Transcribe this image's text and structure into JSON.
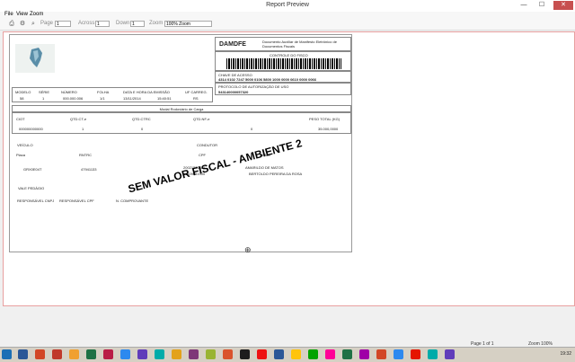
{
  "window": {
    "title": "Report Preview",
    "minimize": "—",
    "maximize": "☐",
    "close": "✕"
  },
  "menu": [
    "File",
    "View",
    "Zoom"
  ],
  "toolbar": {
    "page_label": "Page",
    "page_value": "1",
    "across_label": "Across",
    "across_value": "1",
    "down_label": "Down",
    "down_value": "1",
    "zoom_label": "Zoom",
    "zoom_value": "100% Zoom"
  },
  "report": {
    "damdfe": "DAMDFE",
    "damdfe_desc": "Documento Auxiliar de Manifesto Eletrônico de Documentos Fiscais",
    "controle_label": "CONTROLE DO FISCO",
    "chave_label": "CHAVE DE ACESSO",
    "chave_value": "4314 0102 7247 5000 0106 5800 1000 0000 0610 0000 0066",
    "protocolo_label": "PROTOCOLO DE AUTORIZAÇÃO DE USO",
    "protocolo_value": "543140000057320",
    "ident_headers": [
      "MODELO",
      "SÉRIE",
      "NÚMERO",
      "FOLHA",
      "DATA E HORA DA EMISSÃO",
      "UF CARREG."
    ],
    "ident_values": [
      "58",
      "1",
      "000.000.006",
      "1/1",
      "13/11/2014",
      "15:40:51",
      "RS"
    ],
    "modal_title": "Modal Rodoviário de Carga",
    "ciot_headers": [
      "CIOT",
      "QTD.CT-e",
      "QTD.CTRC",
      "QTD.NF-e",
      "PESO TOTAL (KG)"
    ],
    "ciot_values": [
      "000000000000",
      "1",
      "0",
      "0",
      "35.000,0000"
    ],
    "veiculo_label": "VEÍCULO",
    "condutor_label": "CONDUTOR",
    "placa_label": "Placa",
    "rntrc_label": "RNTRC",
    "cpf_label": "CPF",
    "nome_label": "NOME",
    "placa_value": "GRX0E04T",
    "rntrc_value": "47941133",
    "cpf_values": [
      "20021530887",
      "41109651900"
    ],
    "nome_values": [
      "AMARILDO DE MATOS",
      "BERTOLDO PEREIRA DA ROSA"
    ],
    "vale_pedagio": "VALE PEDÁGIO",
    "resp_headers": [
      "RESPONSÁVEL CNPJ",
      "RESPONSÁVEL CPF",
      "N. COMPROVANTE"
    ],
    "watermark": "SEM VALOR FISCAL - AMBIENTE 2"
  },
  "status": {
    "page": "Page 1 of 1",
    "zoom": "Zoom 100%"
  },
  "taskbar": {
    "clock": "19:32",
    "icon_colors": [
      "#2b5797",
      "#d24726",
      "#c0392b",
      "#f0a030",
      "#1e7145",
      "#b91d47",
      "#2d89ef",
      "#603cba",
      "#00aba9",
      "#e3a21a",
      "#7e3878",
      "#99b433",
      "#da532c",
      "#1d1d1d",
      "#ee1111",
      "#2b5797",
      "#ffc40d",
      "#00a300",
      "#ff0097",
      "#1e7145",
      "#9f00a7",
      "#d24726",
      "#2d89ef",
      "#e51400",
      "#00aba9",
      "#603cba"
    ]
  },
  "colors": {
    "preview_border": "#e8a0a0",
    "close_button": "#c75050"
  }
}
